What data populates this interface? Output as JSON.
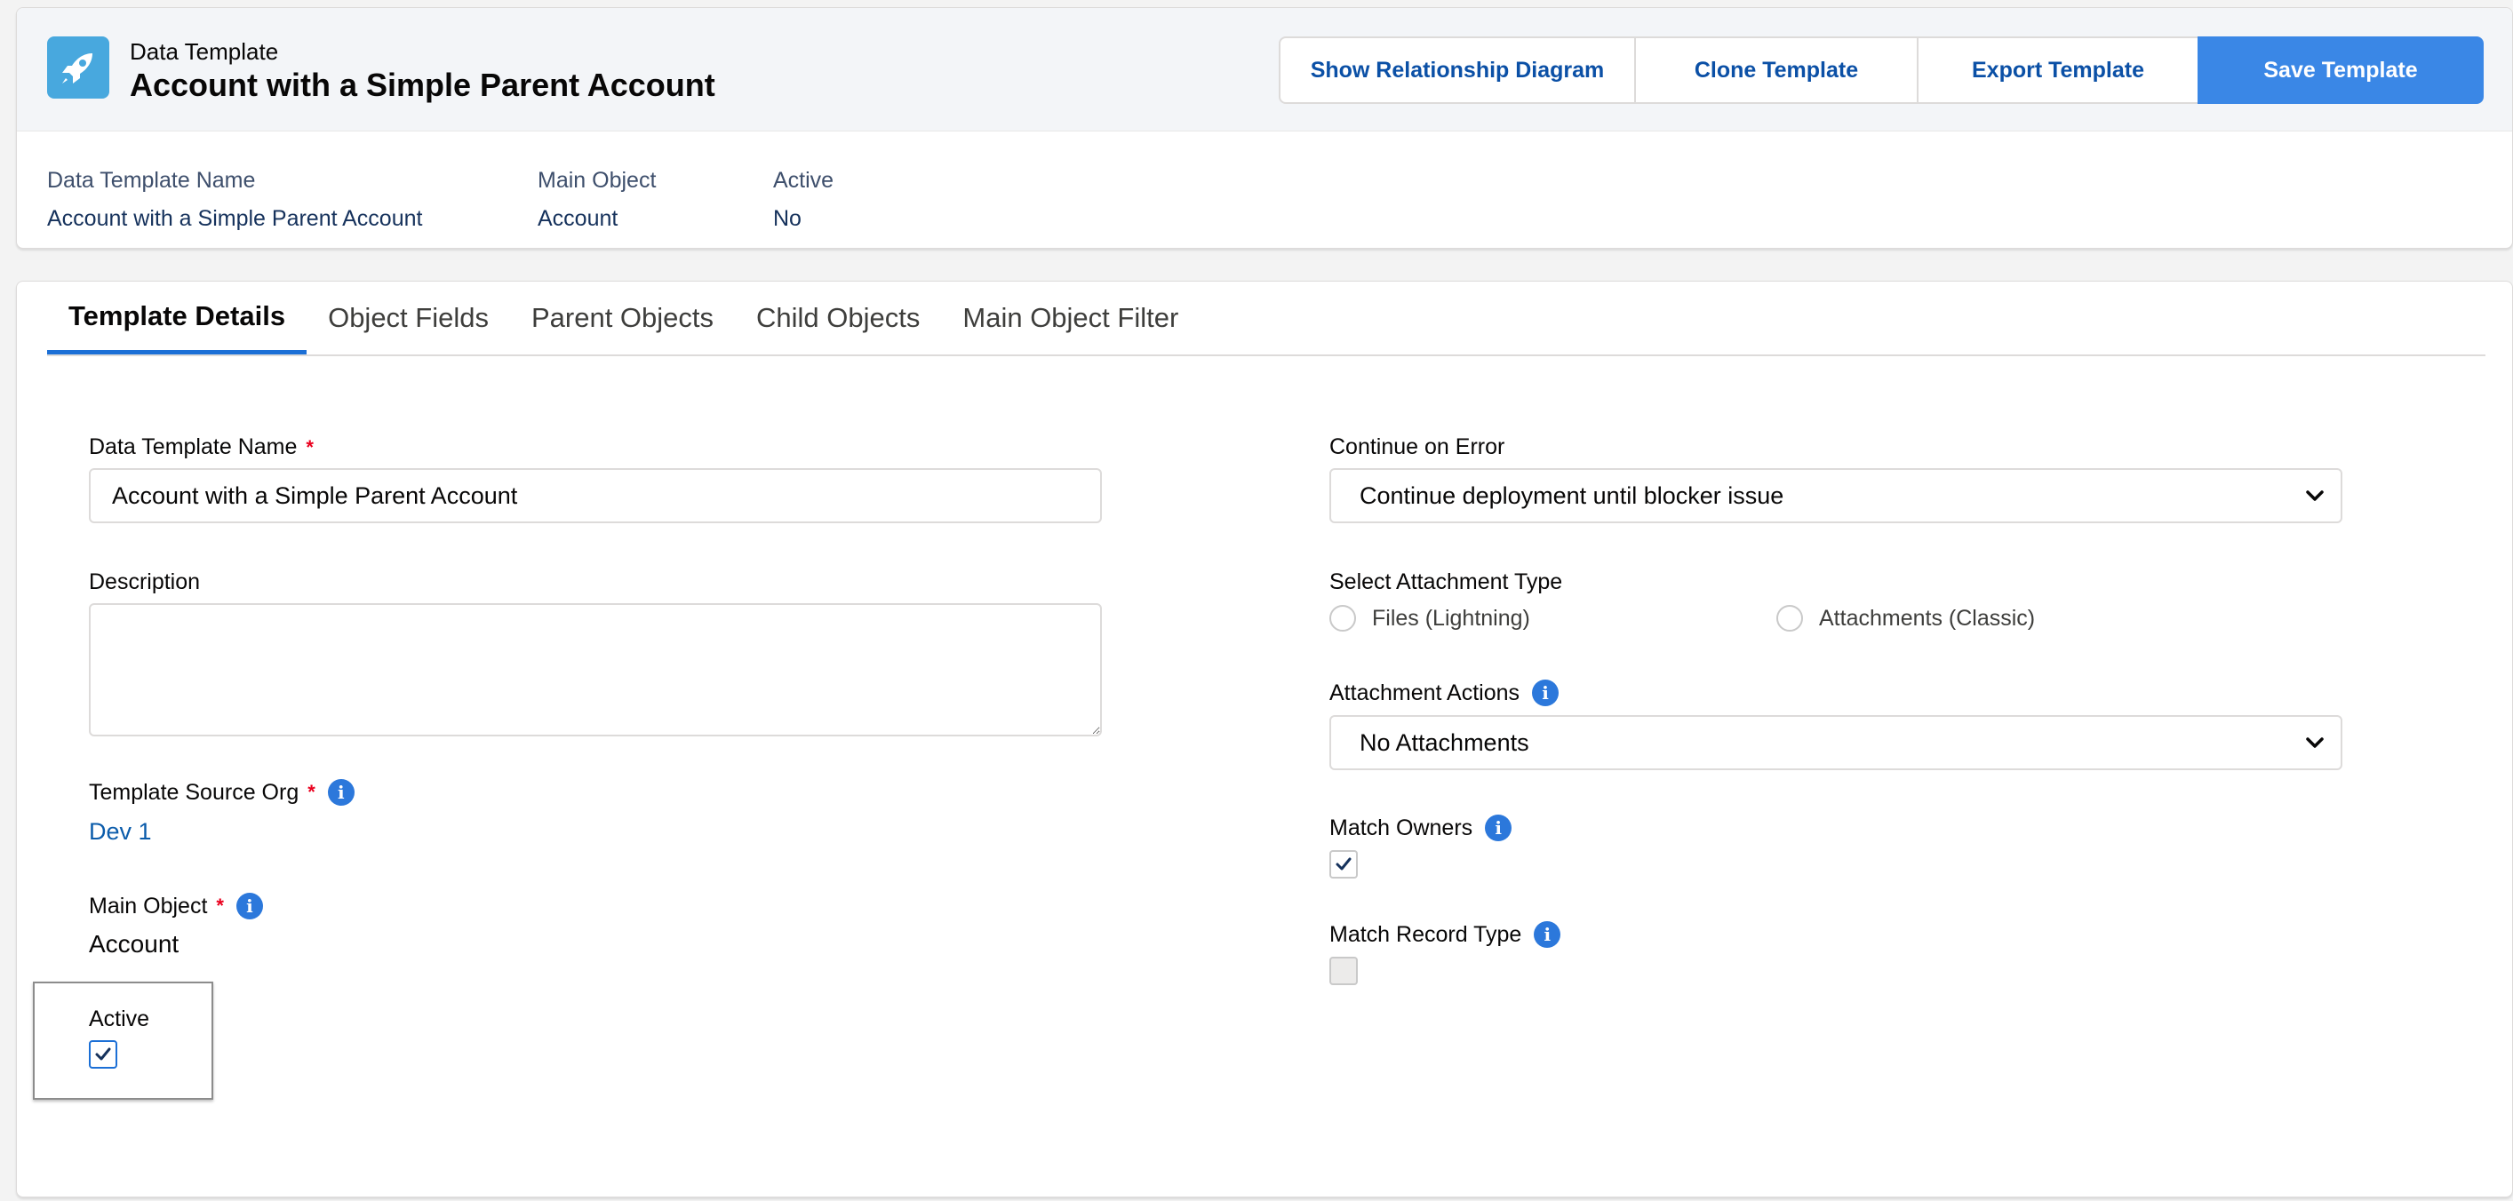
{
  "header": {
    "eyebrow": "Data Template",
    "title": "Account with a Simple Parent Account",
    "icon": "rocket-icon",
    "buttons": {
      "show_diagram": "Show Relationship Diagram",
      "clone": "Clone Template",
      "export": "Export Template",
      "save": "Save Template"
    },
    "highlights": [
      {
        "label": "Data Template Name",
        "value": "Account with a Simple Parent Account"
      },
      {
        "label": "Main Object",
        "value": "Account"
      },
      {
        "label": "Active",
        "value": "No"
      }
    ]
  },
  "tabs": [
    {
      "label": "Template Details",
      "active": true
    },
    {
      "label": "Object Fields",
      "active": false
    },
    {
      "label": "Parent Objects",
      "active": false
    },
    {
      "label": "Child Objects",
      "active": false
    },
    {
      "label": "Main Object Filter",
      "active": false
    }
  ],
  "form": {
    "required_marker": "*",
    "info_glyph": "i",
    "data_template_name": {
      "label": "Data Template Name",
      "value": "Account with a Simple Parent Account"
    },
    "description": {
      "label": "Description",
      "value": ""
    },
    "template_source_org": {
      "label": "Template Source Org",
      "value": "Dev 1"
    },
    "main_object": {
      "label": "Main Object",
      "value": "Account"
    },
    "active": {
      "label": "Active",
      "checked": true
    },
    "continue_on_error": {
      "label": "Continue on Error",
      "value": "Continue deployment until blocker issue"
    },
    "attachment_type": {
      "label": "Select Attachment Type",
      "options": [
        "Files (Lightning)",
        "Attachments (Classic)"
      ]
    },
    "attachment_actions": {
      "label": "Attachment Actions",
      "value": "No Attachments"
    },
    "match_owners": {
      "label": "Match Owners",
      "checked": true
    },
    "match_record_type": {
      "label": "Match Record Type",
      "checked": false,
      "disabled": true
    }
  },
  "colors": {
    "brand": "#3a87e6",
    "link": "#0b5cab",
    "tab_active": "#1b6fd6",
    "required": "#ea001e",
    "info": "#2c78db"
  }
}
